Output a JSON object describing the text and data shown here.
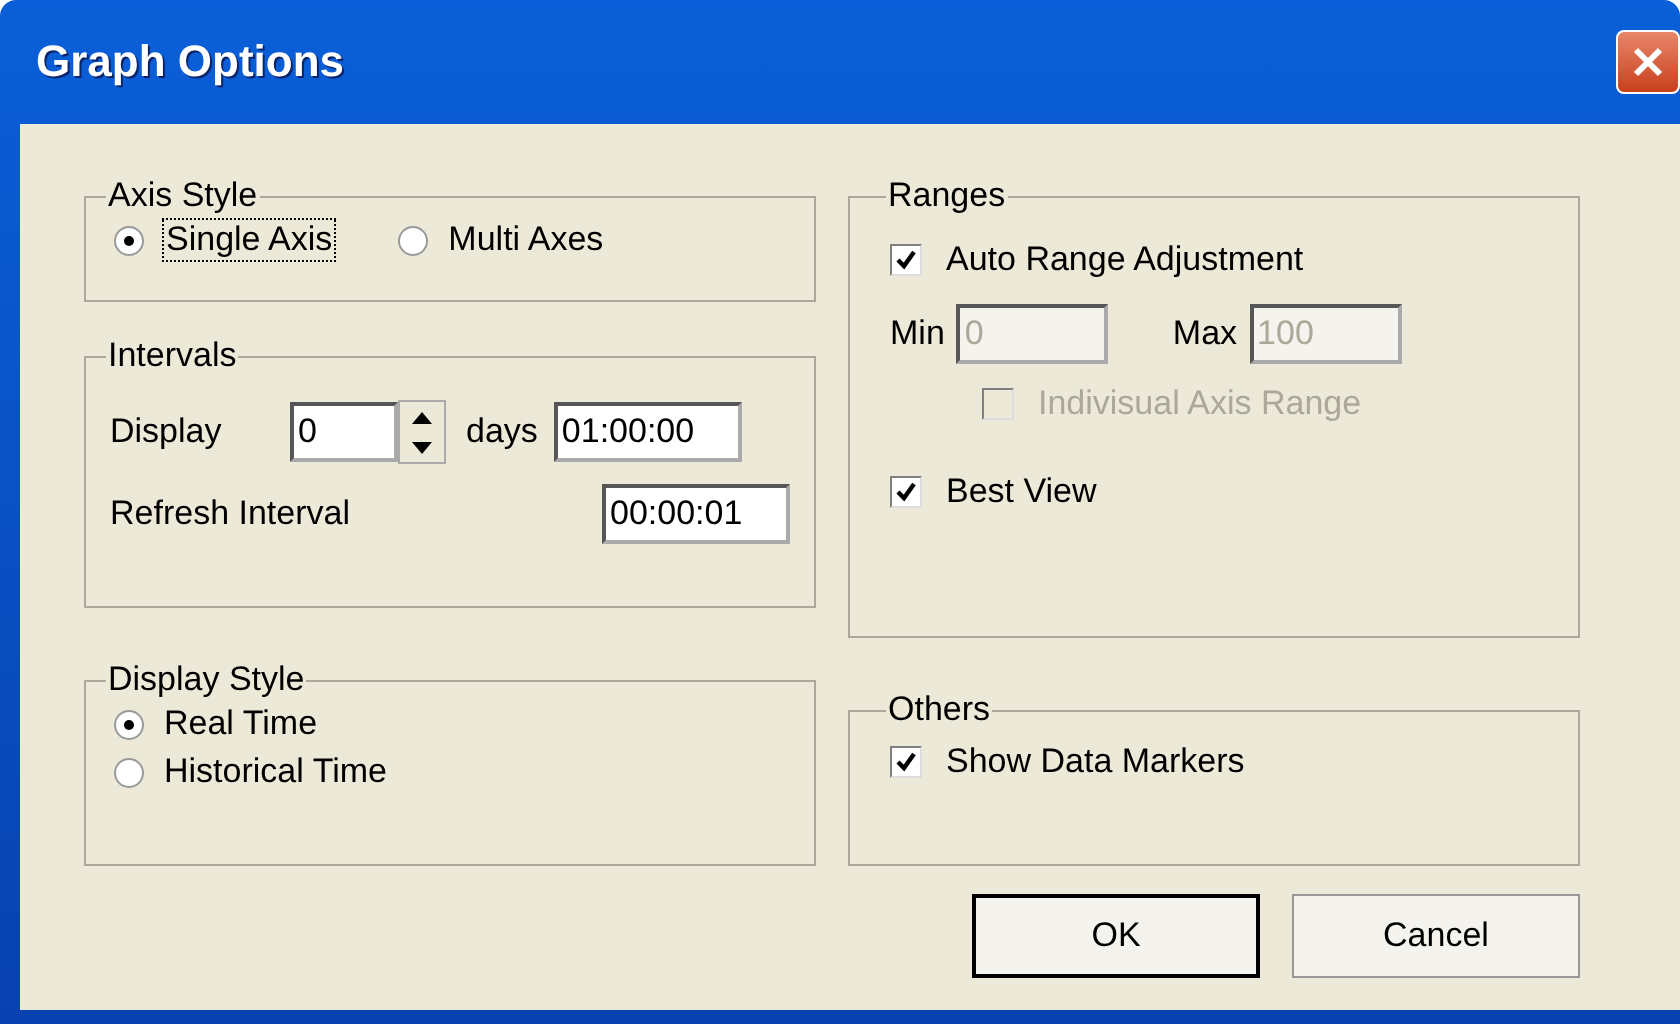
{
  "window": {
    "title": "Graph Options"
  },
  "axis_style": {
    "title": "Axis Style",
    "options": [
      {
        "label": "Single Axis",
        "selected": true,
        "focused": true
      },
      {
        "label": "Multi Axes",
        "selected": false,
        "focused": false
      }
    ]
  },
  "intervals": {
    "title": "Intervals",
    "display_label": "Display",
    "display_value": "0",
    "days_label": "days",
    "display_time": "01:00:00",
    "refresh_label": "Refresh Interval",
    "refresh_time": "00:00:01"
  },
  "display_style": {
    "title": "Display Style",
    "options": [
      {
        "label": "Real Time",
        "selected": true
      },
      {
        "label": "Historical Time",
        "selected": false
      }
    ]
  },
  "ranges": {
    "title": "Ranges",
    "auto": {
      "label": "Auto Range Adjustment",
      "checked": true,
      "disabled": false
    },
    "min_label": "Min",
    "min_value": "0",
    "max_label": "Max",
    "max_value": "100",
    "fields_disabled": true,
    "individual": {
      "label": "Indivisual Axis Range",
      "checked": false,
      "disabled": true
    },
    "best_view": {
      "label": "Best View",
      "checked": true,
      "disabled": false
    }
  },
  "others": {
    "title": "Others",
    "show_markers": {
      "label": "Show Data Markers",
      "checked": true,
      "disabled": false
    }
  },
  "buttons": [
    {
      "label": "OK",
      "default": true
    },
    {
      "label": "Cancel",
      "default": false
    }
  ]
}
